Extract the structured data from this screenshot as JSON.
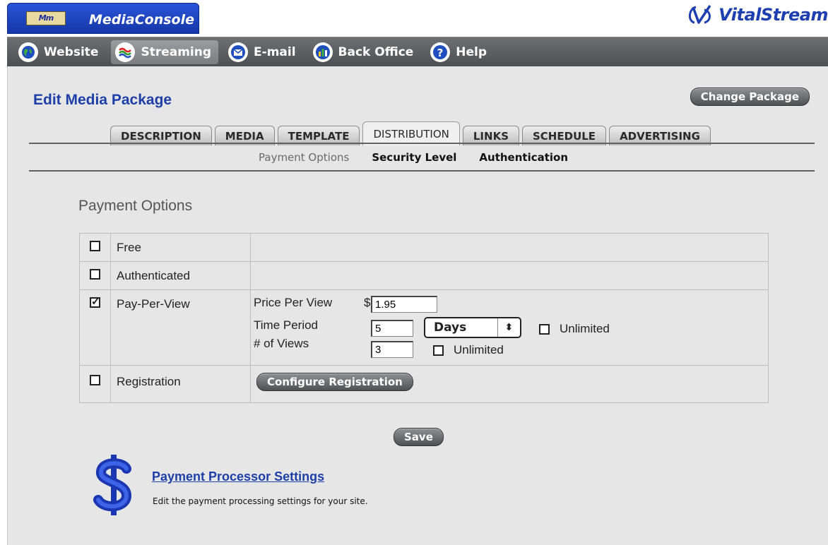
{
  "header": {
    "logo_text": "Mm",
    "app_title": "MediaConsole",
    "brand_name": "VitalStream"
  },
  "nav": [
    {
      "label": "Website",
      "icon": "globe-icon",
      "active": false
    },
    {
      "label": "Streaming",
      "icon": "stream-waves-icon",
      "active": true
    },
    {
      "label": "E-mail",
      "icon": "email-icon",
      "active": false
    },
    {
      "label": "Back Office",
      "icon": "bar-chart-icon",
      "active": false
    },
    {
      "label": "Help",
      "icon": "help-icon",
      "active": false
    }
  ],
  "page": {
    "title": "Edit Media Package",
    "change_package_label": "Change Package"
  },
  "tabs": [
    "DESCRIPTION",
    "MEDIA",
    "TEMPLATE",
    "DISTRIBUTION",
    "LINKS",
    "SCHEDULE",
    "ADVERTISING"
  ],
  "active_tab": "DISTRIBUTION",
  "subnav": [
    "Payment Options",
    "Security Level",
    "Authentication"
  ],
  "active_subnav": "Payment Options",
  "section_title": "Payment Options",
  "options": {
    "free": {
      "label": "Free",
      "checked": false
    },
    "authenticated": {
      "label": "Authenticated",
      "checked": false
    },
    "ppv": {
      "label": "Pay-Per-View",
      "checked": true,
      "price_label": "Price Per View",
      "currency": "$",
      "price_value": "1.95",
      "time_period_label": "Time Period",
      "time_period_value": "5",
      "time_unit": "Days",
      "time_unlimited_label": "Unlimited",
      "time_unlimited_checked": false,
      "views_label": "# of Views",
      "views_value": "3",
      "views_unlimited_label": "Unlimited",
      "views_unlimited_checked": false
    },
    "registration": {
      "label": "Registration",
      "checked": false,
      "configure_label": "Configure Registration"
    }
  },
  "save_label": "Save",
  "payment_processor": {
    "link": "Payment Processor Settings",
    "description": "Edit the payment processing settings for your site."
  },
  "colors": {
    "primary_blue": "#1e3fa8",
    "nav_gray": "#5d5f62",
    "panel_bg": "#e6e6e6"
  }
}
